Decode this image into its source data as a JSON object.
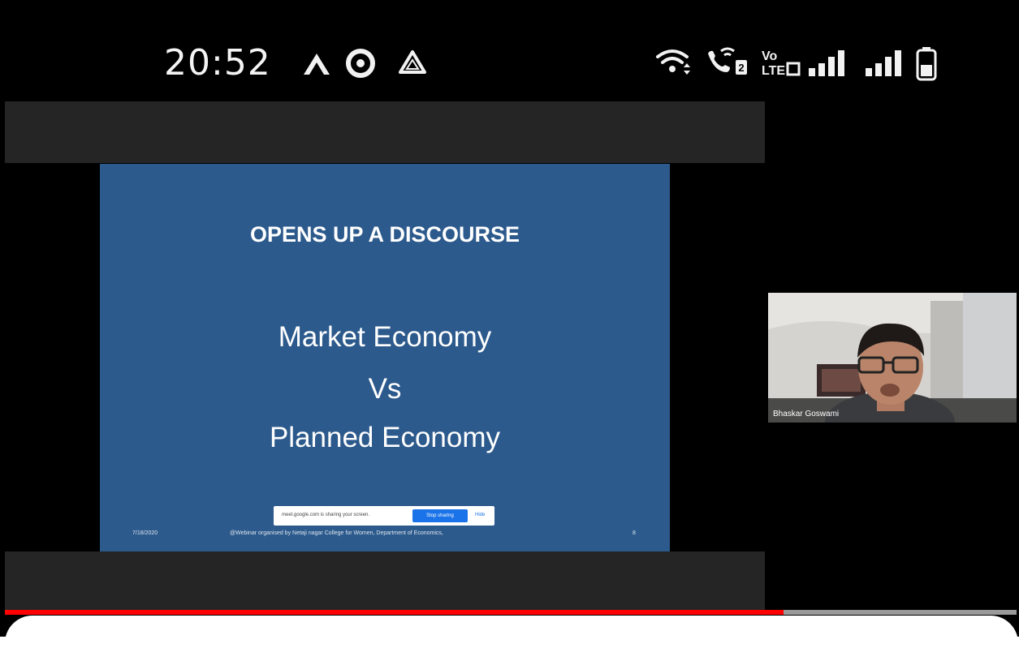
{
  "status_bar": {
    "time": "20:52",
    "left_icons": [
      "airtel-logo-icon",
      "circle-app-icon",
      "drive-icon"
    ],
    "right_icons": [
      "wifi-icon",
      "wifi-calling-icon",
      "volte-icon",
      "signal-icon",
      "signal-icon",
      "battery-icon"
    ],
    "volte_label_top": "Vo",
    "volte_label_bottom": "LTE",
    "sim_number": "2"
  },
  "slide": {
    "title": "OPENS UP A DISCOURSE",
    "line1": "Market Economy",
    "line2": "Vs",
    "line3": "Planned Economy",
    "footer_date": "7/18/2020",
    "footer_text": "@Webinar organised by Netaji nagar College for Women, Department of Economics,",
    "footer_page": "8",
    "share_bar": {
      "text": "meet.google.com is sharing your screen.",
      "stop_label": "Stop sharing",
      "hide_label": "Hide"
    }
  },
  "participant": {
    "name": "Bhaskar Goswami"
  },
  "player": {
    "progress": 0.77
  },
  "colors": {
    "slide_bg": "#2c5a8c",
    "progress": "#ff0000"
  }
}
